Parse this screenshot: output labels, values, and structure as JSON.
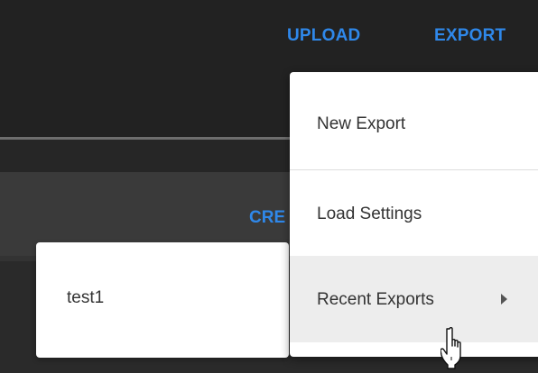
{
  "toolbar": {
    "upload_label": "UPLOAD",
    "export_label": "EXPORT"
  },
  "content": {
    "partial_button_label": "CRE"
  },
  "submenu": {
    "items": [
      {
        "label": "test1"
      }
    ]
  },
  "export_menu": {
    "items": [
      {
        "label": "New Export"
      },
      {
        "label": "Load Settings"
      },
      {
        "label": "Recent Exports",
        "has_submenu": true,
        "icon": "chevron-right-icon"
      }
    ]
  },
  "cursor": {
    "icon": "hand-pointer-icon"
  },
  "colors": {
    "accent": "#2f88ea",
    "background": "#222222",
    "menu_background": "#ffffff",
    "menu_hover": "#ededed",
    "menu_text": "#333333"
  }
}
